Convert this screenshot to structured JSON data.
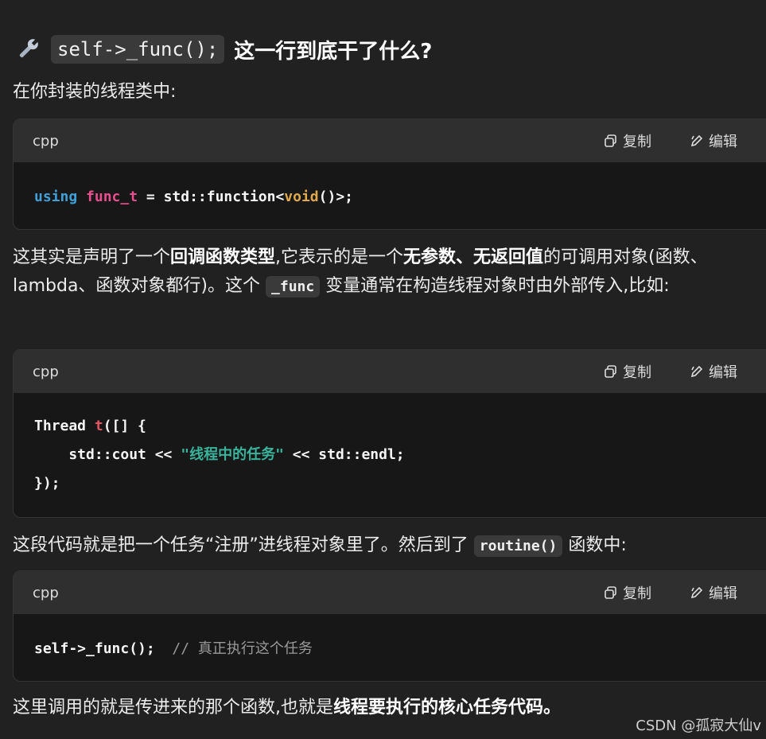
{
  "heading": {
    "icon": "wrench-icon",
    "code": "self->_func();",
    "text": "这一行到底干了什么?"
  },
  "intro": "在你封装的线程类中:",
  "code_blocks": [
    {
      "lang": "cpp",
      "copy_label": "复制",
      "edit_label": "编辑",
      "tokens": {
        "using": "using",
        "name": "func_t",
        "eq": " = std::function<",
        "void": "void",
        "tail": "()>;"
      }
    },
    {
      "lang": "cpp",
      "copy_label": "复制",
      "edit_label": "编辑",
      "tokens": {
        "line1_a": "Thread ",
        "line1_t": "t",
        "line1_b": "([] {",
        "line2_a": "    std::cout << ",
        "line2_str": "\"线程中的任务\"",
        "line2_b": " << std::endl;",
        "line3": "});"
      }
    },
    {
      "lang": "cpp",
      "copy_label": "复制",
      "edit_label": "编辑",
      "tokens": {
        "code": "self->_func();  ",
        "comment": "// 真正执行这个任务"
      }
    }
  ],
  "para1": {
    "a": "这其实是声明了一个",
    "b1": "回调函数类型",
    "c": ",它表示的是一个",
    "b2": "无参数、无返回值",
    "d": "的可调用对象(函数、lambda、函数对象都行)。这个 ",
    "code": "_func",
    "e": " 变量通常在构造线程对象时由外部传入,比如:"
  },
  "para2": {
    "a": "这段代码就是把一个任务“注册”进线程对象里了。然后到了 ",
    "code": "routine()",
    "b": " 函数中:"
  },
  "para3": {
    "a": "这里调用的就是传进来的那个函数,也就是",
    "b": "线程要执行的核心任务代码。"
  },
  "watermark": "CSDN @孤寂大仙v"
}
